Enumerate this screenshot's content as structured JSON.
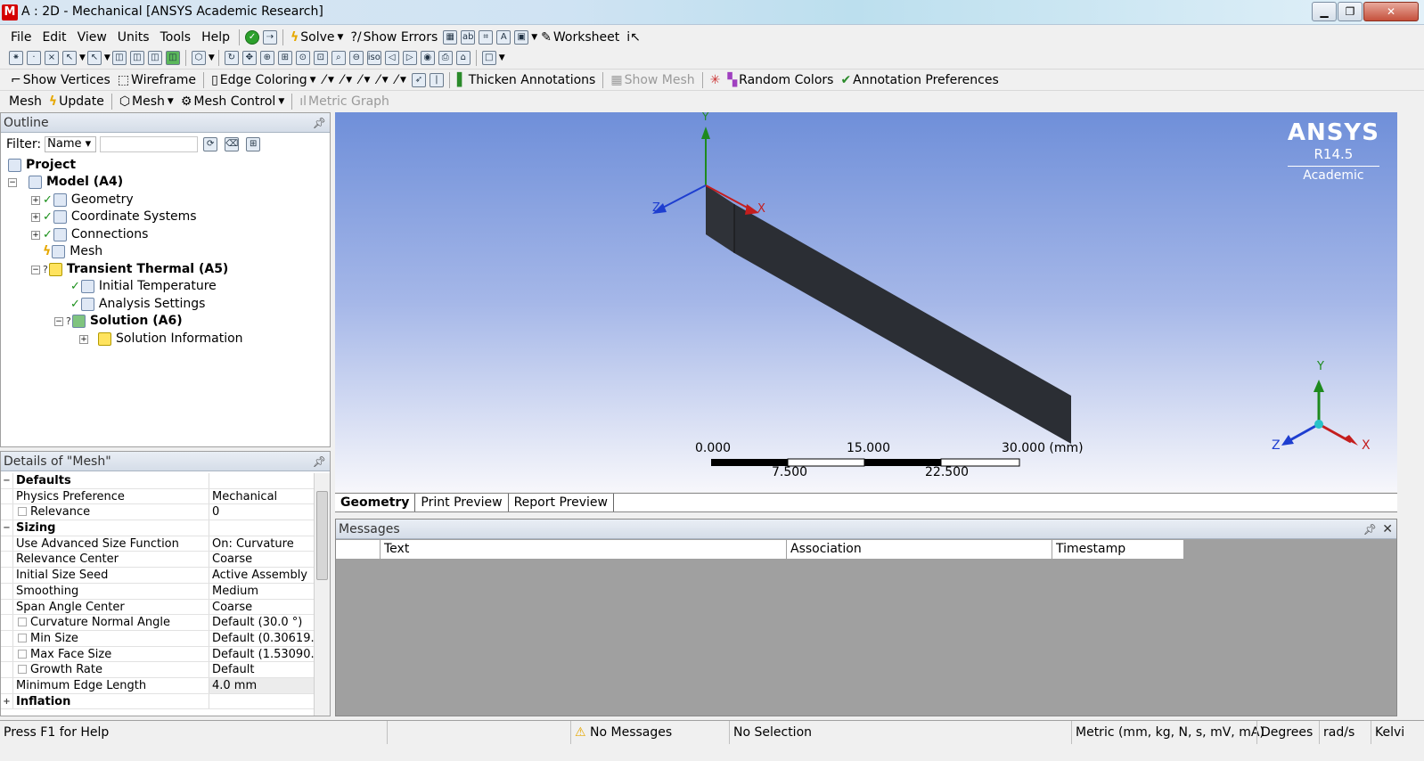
{
  "window": {
    "title": "A : 2D - Mechanical [ANSYS Academic Research]",
    "logo_letter": "M",
    "min_glyph": "▁",
    "max_glyph": "❐",
    "close_glyph": "✕"
  },
  "menubar": {
    "items": [
      "File",
      "Edit",
      "View",
      "Units",
      "Tools",
      "Help"
    ],
    "solve_label": "Solve",
    "show_errors_label": "Show Errors",
    "worksheet_label": "Worksheet"
  },
  "toolbar3": {
    "show_vertices_label": "Show Vertices",
    "wireframe_label": "Wireframe",
    "edge_coloring_label": "Edge Coloring",
    "thicken_annotations_label": "Thicken Annotations",
    "show_mesh_label": "Show Mesh",
    "random_colors_label": "Random Colors",
    "annotation_preferences_label": "Annotation Preferences"
  },
  "toolbar4": {
    "context_label": "Mesh",
    "update_label": "Update",
    "mesh_label": "Mesh",
    "mesh_control_label": "Mesh Control",
    "metric_graph_label": "Metric Graph"
  },
  "outline": {
    "header": "Outline",
    "filter_label": "Filter:",
    "filter_value": "Name",
    "tree": [
      {
        "label": "Project"
      },
      {
        "label": "Model (A4)"
      },
      {
        "label": "Geometry"
      },
      {
        "label": "Coordinate Systems"
      },
      {
        "label": "Connections"
      },
      {
        "label": "Mesh"
      },
      {
        "label": "Transient Thermal (A5)"
      },
      {
        "label": "Initial Temperature"
      },
      {
        "label": "Analysis Settings"
      },
      {
        "label": "Solution (A6)"
      },
      {
        "label": "Solution Information"
      }
    ]
  },
  "details": {
    "header": "Details of \"Mesh\"",
    "rows": [
      {
        "label": "Defaults",
        "value": ""
      },
      {
        "label": "Physics Preference",
        "value": "Mechanical"
      },
      {
        "label": "Relevance",
        "value": "0"
      },
      {
        "label": "Sizing",
        "value": ""
      },
      {
        "label": "Use Advanced Size Function",
        "value": "On: Curvature"
      },
      {
        "label": "Relevance Center",
        "value": "Coarse"
      },
      {
        "label": "Initial Size Seed",
        "value": "Active Assembly"
      },
      {
        "label": "Smoothing",
        "value": "Medium"
      },
      {
        "label": "Span Angle Center",
        "value": "Coarse"
      },
      {
        "label": "Curvature Normal Angle",
        "value": "Default (30.0 °)"
      },
      {
        "label": "Min Size",
        "value": "Default (0.30619..."
      },
      {
        "label": "Max Face Size",
        "value": "Default (1.53090..."
      },
      {
        "label": "Growth Rate",
        "value": "Default"
      },
      {
        "label": "Minimum Edge Length",
        "value": "4.0 mm"
      },
      {
        "label": "Inflation",
        "value": ""
      }
    ]
  },
  "viewport": {
    "brand": "ANSYS",
    "version": "R14.5",
    "edition": "Academic",
    "axis_x": "X",
    "axis_y": "Y",
    "axis_z": "Z",
    "scale_labels": [
      "0.000",
      "15.000",
      "30.000 (mm)",
      "7.500",
      "22.500"
    ]
  },
  "view_tabs": [
    "Geometry",
    "Print Preview",
    "Report Preview"
  ],
  "messages": {
    "header": "Messages",
    "columns": [
      "Text",
      "Association",
      "Timestamp"
    ]
  },
  "statusbar": {
    "help": "Press F1 for Help",
    "messages": "No Messages",
    "selection": "No Selection",
    "units": "Metric (mm, kg, N, s, mV, mA)",
    "angle": "Degrees",
    "rate": "rad/s",
    "temp": "Kelvi"
  }
}
